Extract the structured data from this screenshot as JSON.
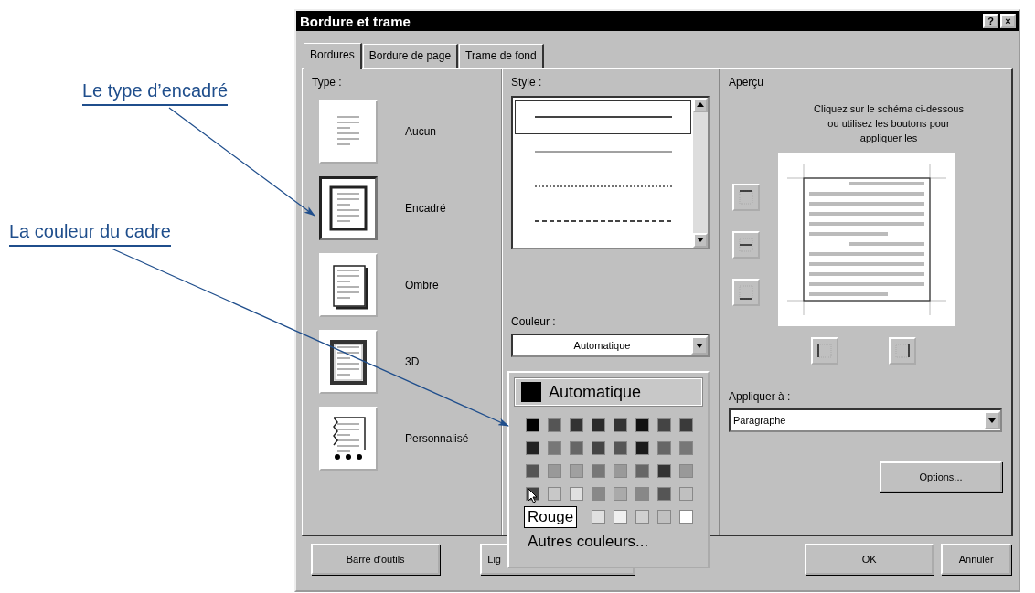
{
  "callouts": [
    {
      "text": "Le type d’encadré"
    },
    {
      "text": "La couleur du cadre"
    }
  ],
  "window": {
    "title": "Bordure et trame",
    "title_buttons": [
      "?",
      "×"
    ]
  },
  "tabs": [
    {
      "label": "Bordures",
      "selected": true
    },
    {
      "label": "Bordure de page",
      "selected": false
    },
    {
      "label": "Trame de fond",
      "selected": false
    }
  ],
  "type": {
    "label": "Type :",
    "items": [
      {
        "label": "Aucun",
        "kind": "none",
        "selected": false
      },
      {
        "label": "Encadré",
        "kind": "box",
        "selected": true
      },
      {
        "label": "Ombre",
        "kind": "shadow",
        "selected": false
      },
      {
        "label": "3D",
        "kind": "threed",
        "selected": false
      },
      {
        "label": "Personnalisé",
        "kind": "custom",
        "selected": false
      }
    ]
  },
  "style": {
    "label": "Style :",
    "items": [
      {
        "kind": "solid",
        "selected": true
      },
      {
        "kind": "thin",
        "selected": false
      },
      {
        "kind": "dotted",
        "selected": false
      },
      {
        "kind": "dashed",
        "selected": false
      }
    ]
  },
  "color": {
    "label": "Couleur :",
    "value": "Automatique"
  },
  "palette": {
    "automatic": "Automatique",
    "swatch_rows": [
      [
        {
          "color": "#000000"
        },
        {
          "color": "#555555"
        },
        {
          "color": "#333333"
        },
        {
          "color": "#2a2a2a"
        },
        {
          "color": "#333333"
        },
        {
          "color": "#111111"
        },
        {
          "color": "#444444"
        },
        {
          "color": "#3a3a3a"
        }
      ],
      [
        {
          "color": "#222222"
        },
        {
          "color": "#777777"
        },
        {
          "color": "#666666"
        },
        {
          "color": "#444444"
        },
        {
          "color": "#555555"
        },
        {
          "color": "#1a1a1a"
        },
        {
          "color": "#666666"
        },
        {
          "color": "#777777"
        }
      ],
      [
        {
          "color": "#555555"
        },
        {
          "color": "#999999"
        },
        {
          "color": "#a0a0a0"
        },
        {
          "color": "#777777"
        },
        {
          "color": "#999999"
        },
        {
          "color": "#666666"
        },
        {
          "color": "#333333"
        },
        {
          "color": "#999999"
        }
      ],
      [
        {
          "color": "#444444"
        },
        {
          "color": "#c8c8c8"
        },
        {
          "color": "#e0e0e0"
        },
        {
          "color": "#888888"
        },
        {
          "color": "#aaaaaa"
        },
        {
          "color": "#888888"
        },
        {
          "color": "#555555"
        },
        {
          "color": "#c0c0c0"
        }
      ],
      [
        {
          "color": "#e0e0e0"
        },
        {
          "color": "#f0f0f0"
        },
        {
          "color": "#d0d0d0"
        },
        {
          "color": "#c0c0c0"
        },
        {
          "color": "#ffffff"
        }
      ]
    ],
    "tooltip": "Rouge",
    "more": "Autres couleurs..."
  },
  "preview": {
    "label": "Aperçu",
    "hint": "Cliquez sur le schéma ci-dessous ou utilisez les boutons pour appliquer les"
  },
  "apply": {
    "label": "Appliquer à :",
    "value": "Paragraphe"
  },
  "options_button": "Options...",
  "footer_buttons": [
    "Barre d'outils",
    "Lig",
    "OK",
    "Annuler"
  ]
}
